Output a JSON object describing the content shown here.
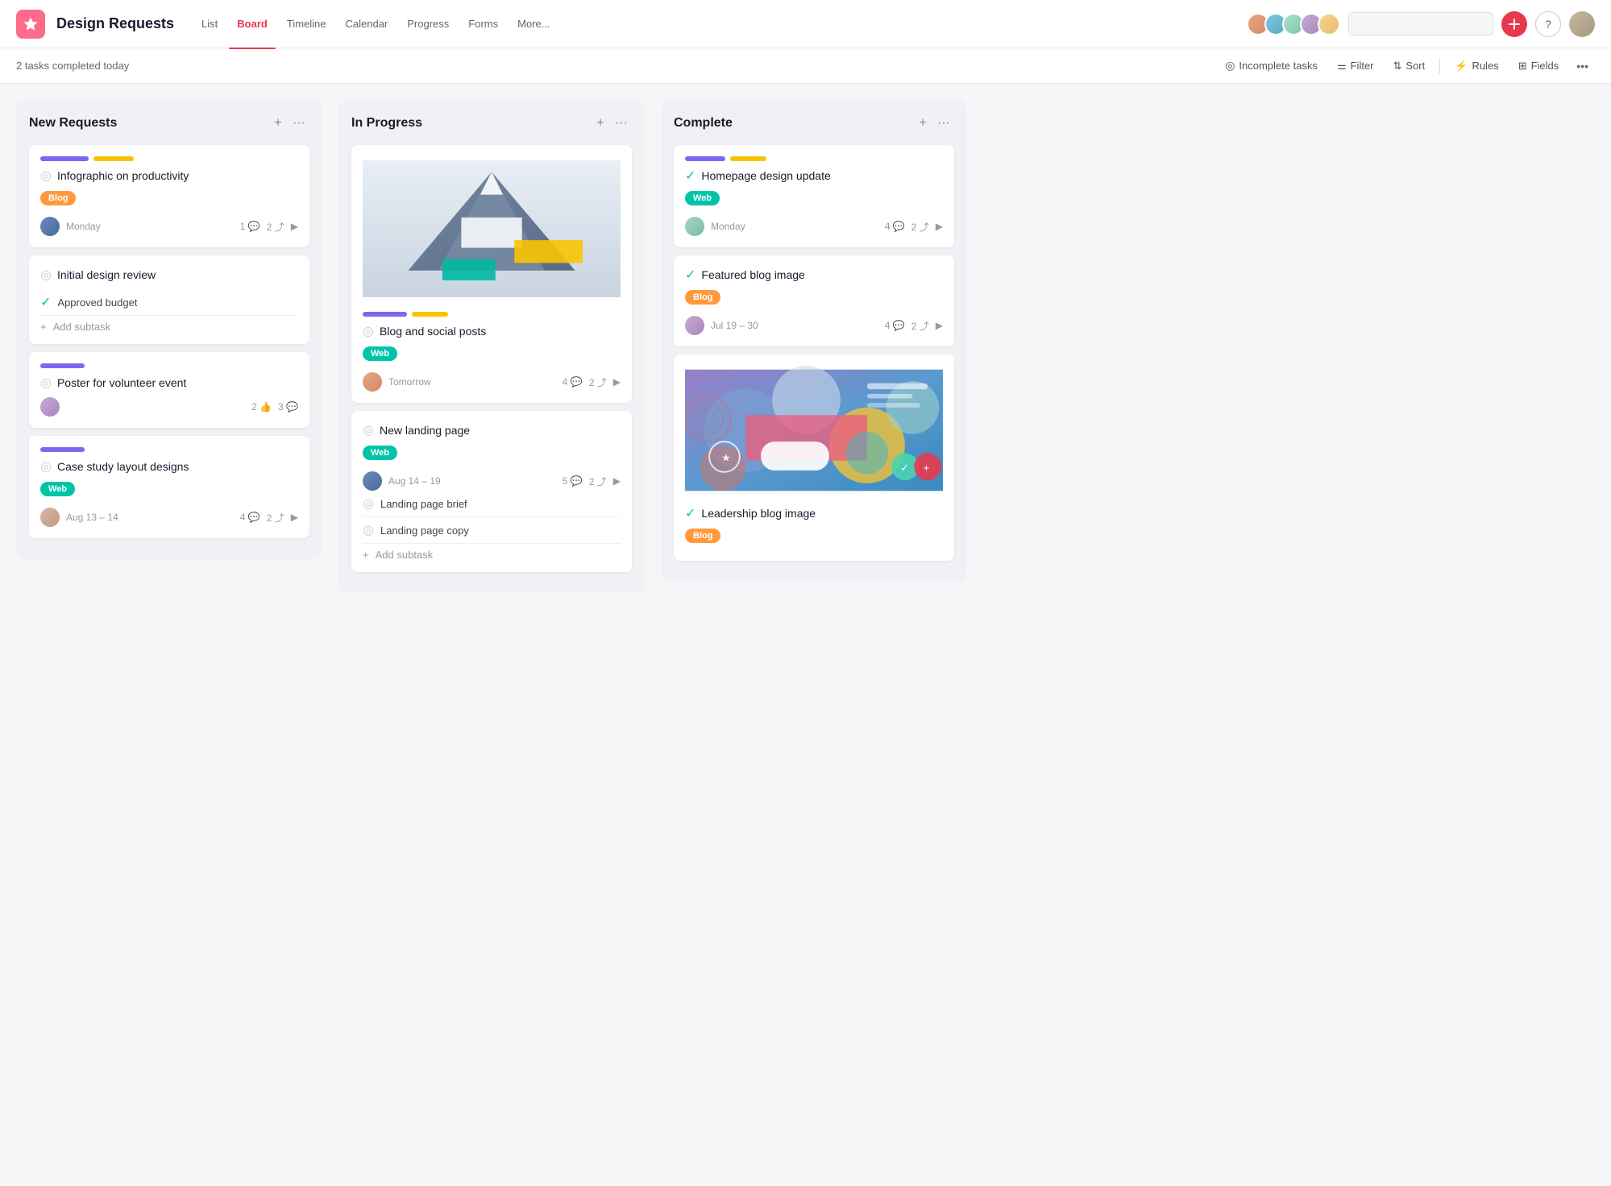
{
  "app": {
    "icon": "★",
    "title": "Design Requests",
    "nav": [
      "List",
      "Board",
      "Timeline",
      "Calendar",
      "Progress",
      "Forms",
      "More..."
    ],
    "active_nav": "Board"
  },
  "toolbar": {
    "tasks_completed": "2 tasks completed today",
    "incomplete_tasks": "Incomplete tasks",
    "filter": "Filter",
    "sort": "Sort",
    "rules": "Rules",
    "fields": "Fields"
  },
  "columns": [
    {
      "id": "new-requests",
      "title": "New Requests",
      "cards": [
        {
          "id": "card-1",
          "tags": [
            "purple",
            "yellow"
          ],
          "tag_widths": [
            60,
            50
          ],
          "title": "Infographic on productivity",
          "badge": "Blog",
          "badge_type": "blog",
          "avatar_class": "cav1",
          "date": "Monday",
          "comments": "1",
          "subtasks_count": "2",
          "has_arrow": true,
          "subtasks": [],
          "add_subtask": false,
          "has_image": false
        },
        {
          "id": "card-2",
          "tags": [],
          "title": "Initial design review",
          "badge": null,
          "subtasks": [
            "Approved budget"
          ],
          "add_subtask": true,
          "has_image": false
        },
        {
          "id": "card-3",
          "tags": [
            "purple"
          ],
          "tag_widths": [
            55
          ],
          "title": "Poster for volunteer event",
          "badge": null,
          "avatar_class": "cav2",
          "date": null,
          "likes": "2",
          "comments": "3",
          "has_image": false,
          "add_subtask": false,
          "subtasks": []
        },
        {
          "id": "card-4",
          "tags": [
            "purple"
          ],
          "tag_widths": [
            55
          ],
          "title": "Case study layout designs",
          "badge": "Web",
          "badge_type": "web",
          "avatar_class": "cav5",
          "date": "Aug 13 – 14",
          "comments": "4",
          "subtasks_count": "2",
          "has_arrow": true,
          "subtasks": [],
          "add_subtask": false,
          "has_image": false
        }
      ]
    },
    {
      "id": "in-progress",
      "title": "In Progress",
      "cards": [
        {
          "id": "card-5",
          "has_image": true,
          "tags": [
            "purple",
            "yellow"
          ],
          "tag_widths": [
            55,
            45
          ],
          "title": "Blog and social posts",
          "badge": "Web",
          "badge_type": "web",
          "avatar_class": "cav4",
          "date": "Tomorrow",
          "comments": "4",
          "subtasks_count": "2",
          "has_arrow": true,
          "subtasks": [],
          "add_subtask": false
        },
        {
          "id": "card-6",
          "has_image": false,
          "tags": [],
          "title": "New landing page",
          "badge": "Web",
          "badge_type": "web",
          "avatar_class": "cav1",
          "date": "Aug 14 – 19",
          "comments": "5",
          "subtasks_count": "2",
          "has_arrow": true,
          "subtasks": [
            "Landing page brief",
            "Landing page copy"
          ],
          "add_subtask": true
        }
      ]
    },
    {
      "id": "complete",
      "title": "Complete",
      "cards": [
        {
          "id": "card-7",
          "has_image": false,
          "tags": [
            "purple",
            "yellow"
          ],
          "tag_widths": [
            50,
            45
          ],
          "title": "Homepage design update",
          "badge": "Web",
          "badge_type": "web",
          "avatar_class": "cav3",
          "date": "Monday",
          "comments": "4",
          "subtasks_count": "2",
          "has_arrow": true,
          "subtasks": [],
          "add_subtask": false,
          "completed": true
        },
        {
          "id": "card-8",
          "has_image": false,
          "tags": [],
          "title": "Featured blog image",
          "badge": "Blog",
          "badge_type": "blog",
          "avatar_class": "cav2",
          "date": "Jul 19 – 30",
          "comments": "4",
          "subtasks_count": "2",
          "has_arrow": true,
          "subtasks": [],
          "add_subtask": false,
          "completed": true
        },
        {
          "id": "card-9",
          "has_image": true,
          "has_leadership_img": true,
          "tags": [],
          "title": "Leadership blog image",
          "badge": "Blog",
          "badge_type": "blog",
          "subtasks": [],
          "add_subtask": false,
          "completed": true
        }
      ]
    }
  ]
}
